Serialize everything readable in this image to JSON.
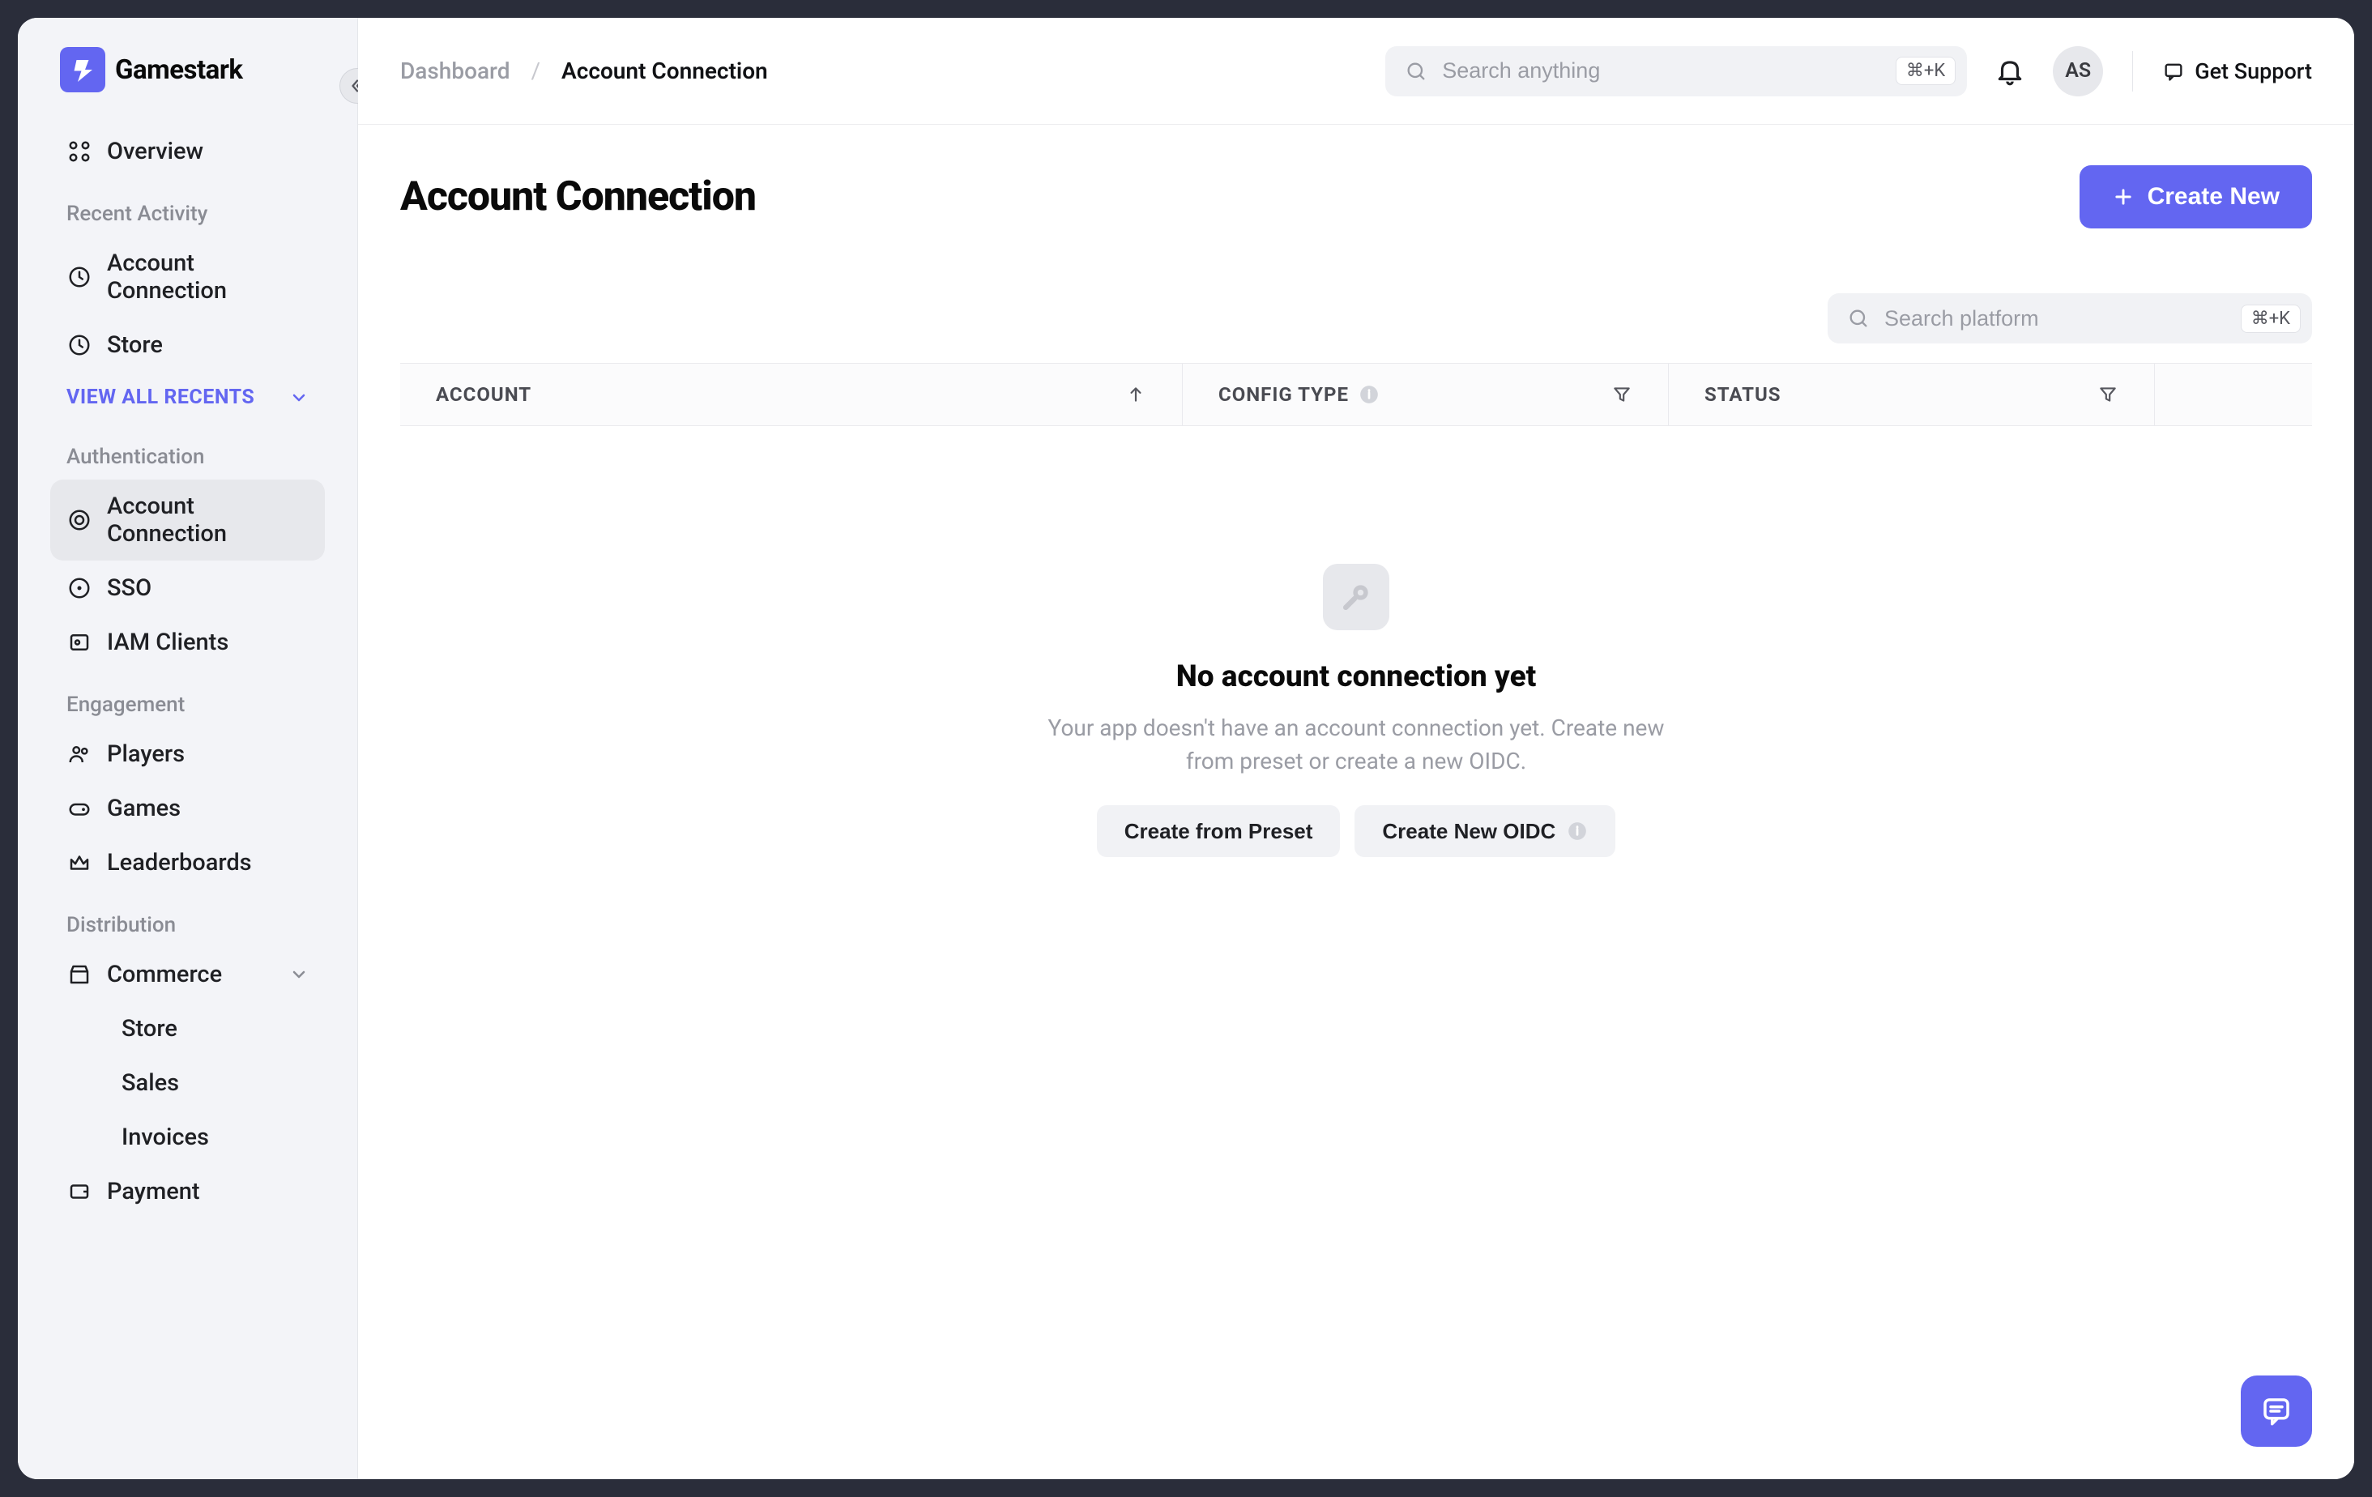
{
  "brand": "Gamestark",
  "sidebar": {
    "overview": "Overview",
    "recent_header": "Recent Activity",
    "recent1": "Account Connection",
    "recent2": "Store",
    "view_all": "VIEW ALL RECENTS",
    "auth_header": "Authentication",
    "auth1": "Account Connection",
    "auth2": "SSO",
    "auth3": "IAM Clients",
    "engage_header": "Engagement",
    "engage1": "Players",
    "engage2": "Games",
    "engage3": "Leaderboards",
    "dist_header": "Distribution",
    "dist1": "Commerce",
    "dist1a": "Store",
    "dist1b": "Sales",
    "dist1c": "Invoices",
    "dist2": "Payment"
  },
  "topbar": {
    "crumb1": "Dashboard",
    "sep": "/",
    "crumb2": "Account Connection",
    "search_placeholder": "Search anything",
    "kbd": "⌘+K",
    "avatar": "AS",
    "support": "Get Support"
  },
  "page": {
    "title": "Account Connection",
    "create_new": "Create New"
  },
  "filters": {
    "platform_placeholder": "Search platform",
    "kbd": "⌘+K"
  },
  "table": {
    "account": "ACCOUNT",
    "config": "CONFIG TYPE",
    "status": "STATUS"
  },
  "empty": {
    "title": "No account connection yet",
    "desc": "Your app doesn't have an account connection yet. Create new from preset or create a new OIDC.",
    "preset": "Create from Preset",
    "oidc": "Create New OIDC"
  }
}
